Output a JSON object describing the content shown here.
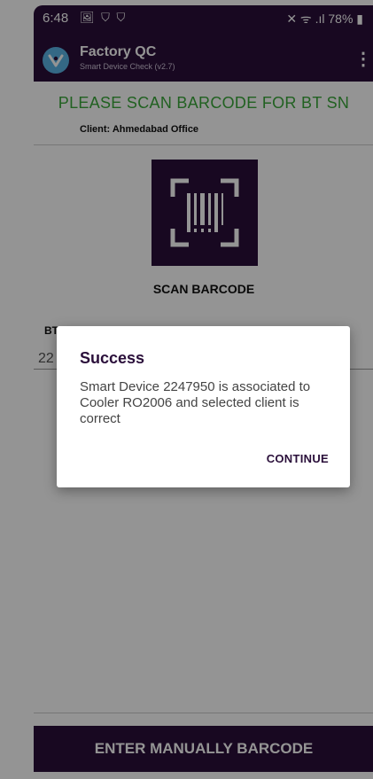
{
  "status_bar": {
    "time": "6:48",
    "left_icons": "🖼 ⛉ ⛉",
    "right": "✕ ᯤ .ıl 78% ▮"
  },
  "app_bar": {
    "title": "Factory QC",
    "subtitle": "Smart Device Check (v2.7)",
    "menu_icon": "⋮"
  },
  "main": {
    "scan_header": "PLEASE SCAN BARCODE FOR BT SN",
    "client": "Client: Ahmedabad Office",
    "scan_button_label": "SCAN BARCODE",
    "field_label": "BT SN",
    "field_value": "22",
    "manual_button_label": "ENTER MANUALLY BARCODE"
  },
  "dialog": {
    "title": "Success",
    "message": "Smart Device 2247950 is associated to Cooler RO2006 and selected client is correct",
    "button": "CONTINUE"
  },
  "colors": {
    "primary": "#2a0f3a",
    "header_green": "#3aa83a",
    "logo_blue": "#5ab4e6"
  }
}
